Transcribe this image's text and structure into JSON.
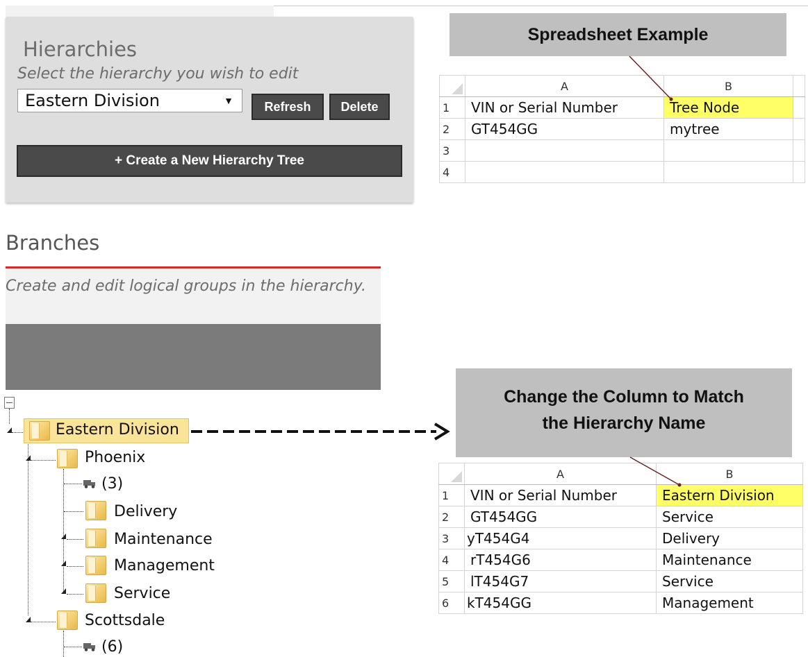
{
  "hierarchies": {
    "title": "Hierarchies",
    "subtitle": "Select the hierarchy you wish to edit",
    "selected": "Eastern Division",
    "select_arrow": "▼",
    "refresh_label": "Refresh",
    "delete_label": "Delete",
    "create_label": "+ Create a New Hierarchy Tree"
  },
  "branches": {
    "title": "Branches",
    "subtitle": "Create and edit logical groups in the hierarchy."
  },
  "tree": {
    "root": "Eastern Division",
    "phoenix": "Phoenix",
    "phoenix_count": "(3)",
    "delivery": "Delivery",
    "maintenance": "Maintenance",
    "management": "Management",
    "service": "Service",
    "scottsdale": "Scottsdale",
    "scottsdale_count": "(6)"
  },
  "callouts": {
    "first": "Spreadsheet Example",
    "second_line1": "Change the Column to Match",
    "second_line2": "the Hierarchy Name"
  },
  "sheet1": {
    "col_a": "A",
    "col_b": "B",
    "rows": [
      {
        "n": "1",
        "a": "VIN or Serial Number",
        "b": "Tree Node"
      },
      {
        "n": "2",
        "a": "GT454GG",
        "b": "mytree"
      },
      {
        "n": "3",
        "a": "",
        "b": ""
      },
      {
        "n": "4",
        "a": "",
        "b": ""
      }
    ]
  },
  "sheet2": {
    "col_a": "A",
    "col_b": "B",
    "rows": [
      {
        "n": "1",
        "a": "VIN or Serial Number",
        "b": "Eastern Division"
      },
      {
        "n": "2",
        "a": "GT454GG",
        "b": "Service"
      },
      {
        "n": "3",
        "a": "yT454G4",
        "b": "Delivery"
      },
      {
        "n": "4",
        "a": "rT454G6",
        "b": "Maintenance"
      },
      {
        "n": "5",
        "a": "lT454G7",
        "b": "Service"
      },
      {
        "n": "6",
        "a": "kT454GG",
        "b": "Management"
      }
    ]
  },
  "colors": {
    "highlight": "#ffff66",
    "accent_red": "#d42a2a",
    "button_dark": "#4a4a4a",
    "callout_gray": "#bfbfbf"
  }
}
